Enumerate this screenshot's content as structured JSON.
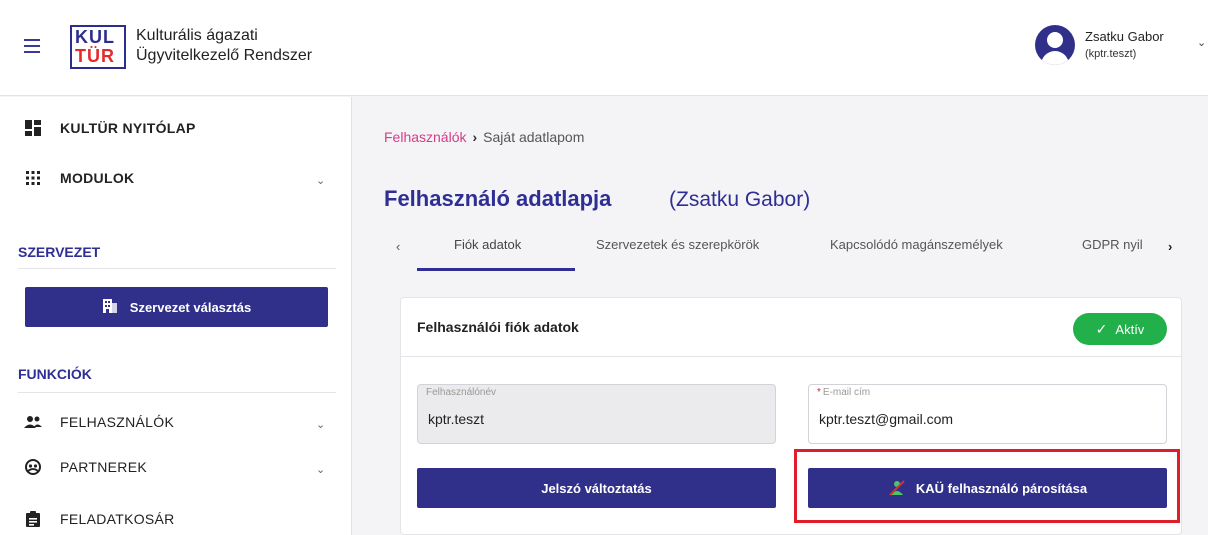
{
  "header": {
    "logo_line1_a": "KUL",
    "logo_line2_a": "TÜR",
    "app_title_line1": "Kulturális ágazati",
    "app_title_line2": "Ügyvitelkezelő Rendszer",
    "user_name": "Zsatku Gabor",
    "user_login": "(kptr.teszt)"
  },
  "sidebar": {
    "home_label": "KULTÜR NYITÓLAP",
    "modules_label": "MODULOK",
    "org_section_title": "SZERVEZET",
    "org_button_label": "Szervezet választás",
    "functions_section_title": "FUNKCIÓK",
    "items": [
      {
        "label": "FELHASZNÁLÓK"
      },
      {
        "label": "PARTNEREK"
      },
      {
        "label": "FELADATKOSÁR"
      }
    ]
  },
  "breadcrumb": {
    "parent": "Felhasználók",
    "current": "Saját adatlapom"
  },
  "page": {
    "title": "Felhasználó adatlapja",
    "subtitle": "(Zsatku Gabor)"
  },
  "tabs": [
    {
      "label": "Fiók adatok",
      "active": true
    },
    {
      "label": "Szervezetek és szerepkörök",
      "active": false
    },
    {
      "label": "Kapcsolódó magánszemélyek",
      "active": false
    },
    {
      "label": "GDPR nyil",
      "active": false
    }
  ],
  "card": {
    "title": "Felhasználói fiók adatok",
    "status_badge": "Aktív",
    "username_label": "Felhasználónév",
    "username_value": "kptr.teszt",
    "email_label": "E-mail cím",
    "email_value": "kptr.teszt@gmail.com",
    "password_button": "Jelszó változtatás",
    "kau_button": "KAÜ felhasználó párosítása"
  },
  "colors": {
    "brand": "#2e2e95",
    "button": "#30308a",
    "status_active": "#22b04b",
    "breadcrumb_link": "#d63b8b",
    "highlight": "#e01e2b"
  }
}
